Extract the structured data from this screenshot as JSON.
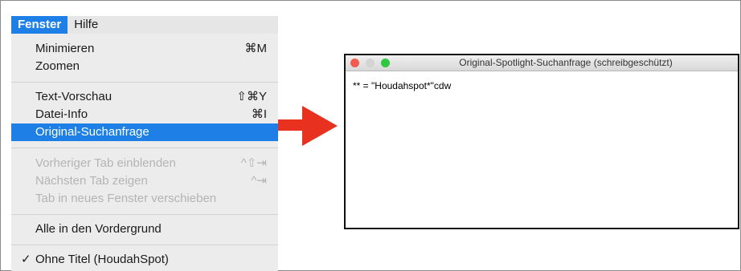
{
  "menubar": {
    "items": [
      {
        "label": "Fenster"
      },
      {
        "label": "Hilfe"
      }
    ]
  },
  "menu": {
    "minimize": {
      "label": "Minimieren",
      "shortcut": "⌘M"
    },
    "zoom": {
      "label": "Zoomen"
    },
    "text_preview": {
      "label": "Text-Vorschau",
      "shortcut": "⇧⌘Y"
    },
    "file_info": {
      "label": "Datei-Info",
      "shortcut": "⌘I"
    },
    "original_query": {
      "label": "Original-Suchanfrage"
    },
    "prev_tab": {
      "label": "Vorheriger Tab einblenden",
      "shortcut": "^⇧⇥"
    },
    "next_tab": {
      "label": "Nächsten Tab zeigen",
      "shortcut": "^⇥"
    },
    "move_tab": {
      "label": "Tab in neues Fenster verschieben"
    },
    "bring_all_front": {
      "label": "Alle in den Vordergrund"
    },
    "window_item": {
      "check": "✓",
      "label": "Ohne Titel (HoudahSpot)"
    }
  },
  "window": {
    "title": "Original-Spotlight-Suchanfrage (schreibgeschützt)",
    "query": "** = \"Houdahspot*\"cdw"
  },
  "colors": {
    "accent": "#1e80e6",
    "arrow": "#e8321f"
  }
}
